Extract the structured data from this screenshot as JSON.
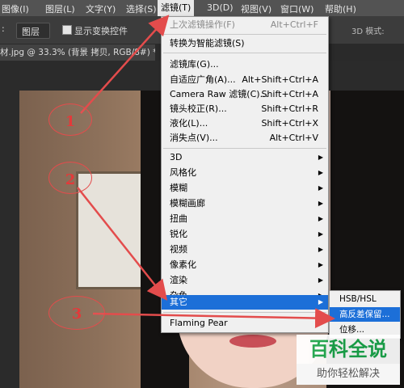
{
  "menubar": {
    "items": [
      "图像(I)",
      "图层(L)",
      "文字(Y)",
      "选择(S)",
      "滤镜(T)",
      "3D(D)",
      "视图(V)",
      "窗口(W)",
      "帮助(H)"
    ],
    "active_index": 4
  },
  "options_bar": {
    "select_value": "图层",
    "checkbox_label": "显示变换控件",
    "mode_label": "3D 模式:"
  },
  "document_tab": {
    "title": "材.jpg @ 33.3% (背景 拷贝, RGB/8#) *"
  },
  "filter_menu": {
    "items": [
      {
        "label": "上次滤镜操作(F)",
        "shortcut": "Alt+Ctrl+F",
        "disabled": true
      },
      {
        "label": "转换为智能滤镜(S)"
      },
      {
        "label": "滤镜库(G)..."
      },
      {
        "label": "自适应广角(A)...",
        "shortcut": "Alt+Shift+Ctrl+A"
      },
      {
        "label": "Camera Raw 滤镜(C)...",
        "shortcut": "Shift+Ctrl+A"
      },
      {
        "label": "镜头校正(R)...",
        "shortcut": "Shift+Ctrl+R"
      },
      {
        "label": "液化(L)...",
        "shortcut": "Shift+Ctrl+X"
      },
      {
        "label": "消失点(V)...",
        "shortcut": "Alt+Ctrl+V"
      },
      {
        "label": "3D",
        "submenu": true
      },
      {
        "label": "风格化",
        "submenu": true
      },
      {
        "label": "模糊",
        "submenu": true
      },
      {
        "label": "模糊画廊",
        "submenu": true
      },
      {
        "label": "扭曲",
        "submenu": true
      },
      {
        "label": "锐化",
        "submenu": true
      },
      {
        "label": "视频",
        "submenu": true
      },
      {
        "label": "像素化",
        "submenu": true
      },
      {
        "label": "渲染",
        "submenu": true
      },
      {
        "label": "杂色",
        "submenu": true
      },
      {
        "label": "其它",
        "submenu": true,
        "highlighted": true
      },
      {
        "label": "Flaming Pear",
        "submenu": true
      }
    ]
  },
  "other_submenu": {
    "items": [
      {
        "label": "HSB/HSL"
      },
      {
        "label": "高反差保留..."
      },
      {
        "label": "位移..."
      }
    ]
  },
  "annotations": [
    "1",
    "2",
    "3"
  ],
  "watermark": {
    "title": "百科全说",
    "subtitle": "助你轻松解决"
  },
  "colors": {
    "menubar": "#535353",
    "highlight": "#1c6fd8",
    "annotation": "#e34c4c",
    "watermark_green": "#19a64a"
  }
}
